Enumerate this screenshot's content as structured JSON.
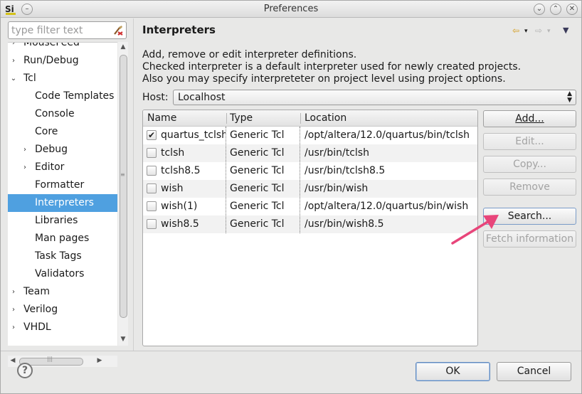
{
  "window": {
    "title": "Preferences",
    "logo_text": "Si"
  },
  "filter": {
    "placeholder": "type filter text"
  },
  "tree": {
    "items": [
      {
        "label": "MouseFeed",
        "arrow": "›",
        "indent": 0
      },
      {
        "label": "Run/Debug",
        "arrow": "›",
        "indent": 0
      },
      {
        "label": "Tcl",
        "arrow": "⌄",
        "indent": 0
      },
      {
        "label": "Code Templates",
        "arrow": "",
        "indent": 2
      },
      {
        "label": "Console",
        "arrow": "",
        "indent": 2
      },
      {
        "label": "Core",
        "arrow": "",
        "indent": 2
      },
      {
        "label": "Debug",
        "arrow": "›",
        "indent": 1
      },
      {
        "label": "Editor",
        "arrow": "›",
        "indent": 1
      },
      {
        "label": "Formatter",
        "arrow": "",
        "indent": 2
      },
      {
        "label": "Interpreters",
        "arrow": "",
        "indent": 2,
        "selected": true
      },
      {
        "label": "Libraries",
        "arrow": "",
        "indent": 2
      },
      {
        "label": "Man pages",
        "arrow": "",
        "indent": 2
      },
      {
        "label": "Task Tags",
        "arrow": "",
        "indent": 2
      },
      {
        "label": "Validators",
        "arrow": "",
        "indent": 2
      },
      {
        "label": "Team",
        "arrow": "›",
        "indent": 0
      },
      {
        "label": "Verilog",
        "arrow": "›",
        "indent": 0
      },
      {
        "label": "VHDL",
        "arrow": "›",
        "indent": 0
      }
    ]
  },
  "page": {
    "title": "Interpreters",
    "description": [
      "Add, remove or edit interpreter definitions.",
      "Checked interpreter is a default interpreter used for newly created projects.",
      "Also you may specify interpreteter on project level using project options."
    ],
    "host_label": "Host:",
    "host_value": "Localhost"
  },
  "table": {
    "columns": [
      "Name",
      "Type",
      "Location"
    ],
    "rows": [
      {
        "checked": true,
        "name": "quartus_tclsh",
        "type": "Generic Tcl",
        "location": "/opt/altera/12.0/quartus/bin/tclsh"
      },
      {
        "checked": false,
        "name": "tclsh",
        "type": "Generic Tcl",
        "location": "/usr/bin/tclsh"
      },
      {
        "checked": false,
        "name": "tclsh8.5",
        "type": "Generic Tcl",
        "location": "/usr/bin/tclsh8.5"
      },
      {
        "checked": false,
        "name": "wish",
        "type": "Generic Tcl",
        "location": "/usr/bin/wish"
      },
      {
        "checked": false,
        "name": "wish(1)",
        "type": "Generic Tcl",
        "location": "/opt/altera/12.0/quartus/bin/wish"
      },
      {
        "checked": false,
        "name": "wish8.5",
        "type": "Generic Tcl",
        "location": "/usr/bin/wish8.5"
      }
    ]
  },
  "buttons": {
    "add": "Add...",
    "edit": "Edit...",
    "copy": "Copy...",
    "remove": "Remove",
    "search": "Search...",
    "fetch": "Fetch information",
    "ok": "OK",
    "cancel": "Cancel",
    "help": "?"
  },
  "colors": {
    "selection": "#4fa0e0",
    "annotation_arrow": "#e8457a"
  }
}
